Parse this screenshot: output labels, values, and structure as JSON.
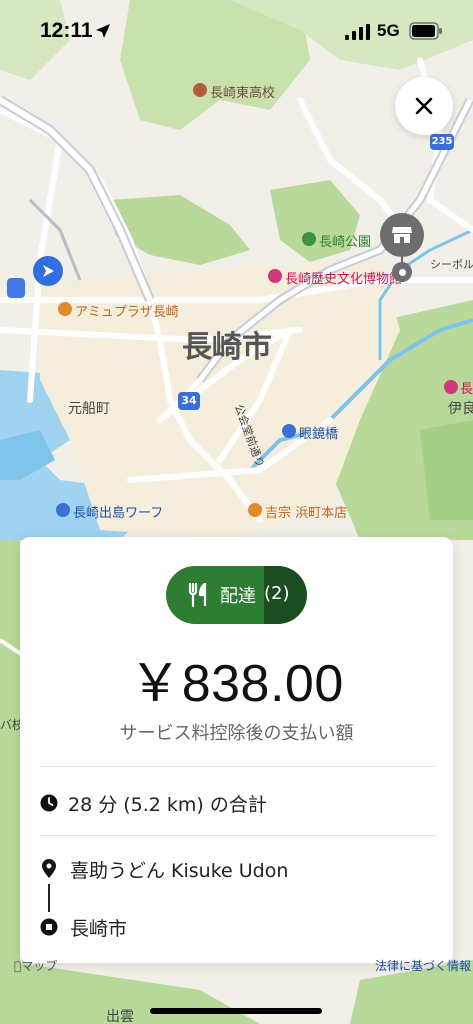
{
  "status_bar": {
    "time": "12:11",
    "network": "5G",
    "icons": [
      "location-arrow-icon",
      "signal-icon",
      "battery-icon"
    ]
  },
  "map": {
    "city_label": "長崎市",
    "labels": {
      "high_school": "長崎東高校",
      "park": "長崎公園",
      "museum": "長崎歴史文化博物館",
      "seaboldt": "シーボル",
      "amu_plaza": "アミュプラザ長崎",
      "motofunamachi": "元船町",
      "route34": "34",
      "route235": "235",
      "megane_bashi": "眼鏡橋",
      "dejima_wharf": "長崎出島ワーフ",
      "yoshimune": "吉宗 浜町本店",
      "kokaido": "公会堂前通り",
      "iyo": "伊良",
      "right_pink": "長",
      "left_edge": "バ枝",
      "izumo": "出雲"
    },
    "attribution": "マップ",
    "legal_link": "法律に基づく情報"
  },
  "buttons": {
    "close": "close-icon"
  },
  "card": {
    "delivery_label": "配達",
    "delivery_count": "(2)",
    "amount": "￥838.00",
    "amount_note": "サービス料控除後の支払い額",
    "trip_summary": "28 分 (5.2 km) の合計",
    "pickup": "喜助うどん Kisuke Udon",
    "dropoff": "長崎市"
  },
  "colors": {
    "accent_green": "#2e7d32",
    "accent_green_dark": "#1b4d20",
    "map_bg": "#f2efe9",
    "park_green": "#b9d99a",
    "water": "#9fd3f0"
  }
}
